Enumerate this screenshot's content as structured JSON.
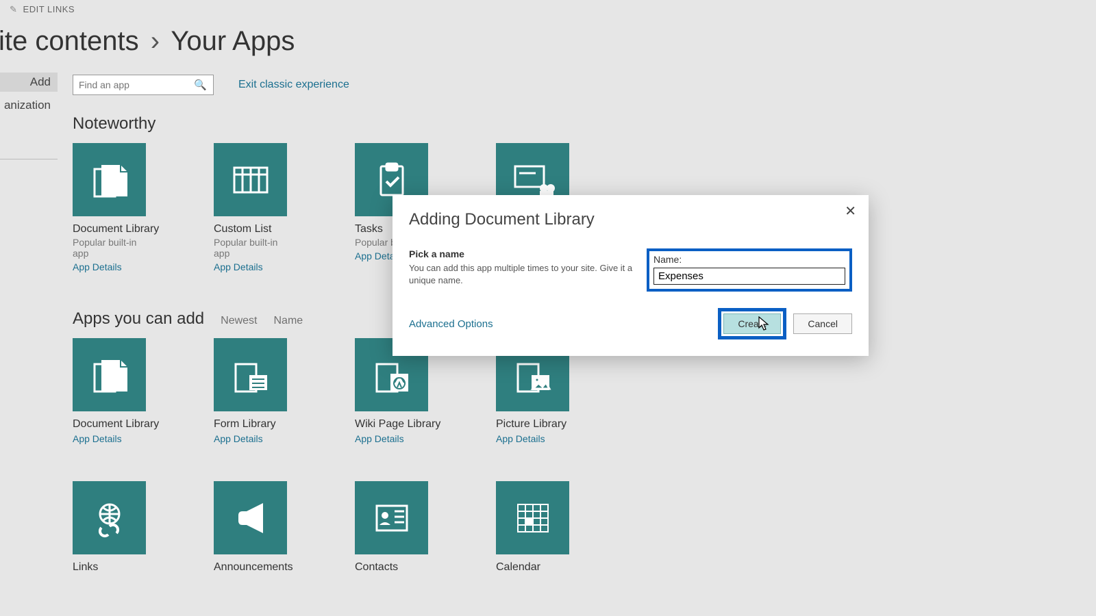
{
  "topbar": {
    "edit_links": "EDIT LINKS"
  },
  "breadcrumb": {
    "site_contents": "ite contents",
    "sep": "›",
    "your_apps": "Your Apps"
  },
  "sidebar": {
    "items": [
      "Add",
      "anization"
    ]
  },
  "search": {
    "placeholder": "Find an app"
  },
  "links": {
    "exit_classic": "Exit classic experience"
  },
  "sections": {
    "noteworthy": "Noteworthy",
    "apps_you_can_add": "Apps you can add",
    "sort_newest": "Newest",
    "sort_name": "Name"
  },
  "strings": {
    "popular": "Popular built-in app",
    "popular_cut": "Popular bu",
    "app_details": "App Details",
    "app_detail_cut": "App Detail"
  },
  "noteworthy": [
    {
      "title": "Document Library"
    },
    {
      "title": "Custom List"
    },
    {
      "title": "Tasks"
    },
    {
      "title": ""
    }
  ],
  "addable_row1": [
    {
      "title": "Document Library"
    },
    {
      "title": "Form Library"
    },
    {
      "title": "Wiki Page Library"
    },
    {
      "title": "Picture Library"
    }
  ],
  "addable_row2": [
    {
      "title": "Links"
    },
    {
      "title": "Announcements"
    },
    {
      "title": "Contacts"
    },
    {
      "title": "Calendar"
    }
  ],
  "dialog": {
    "title": "Adding Document Library",
    "pick_name": "Pick a name",
    "desc": "You can add this app multiple times to your site. Give it a unique name.",
    "name_label": "Name:",
    "name_value": "Expenses",
    "advanced": "Advanced Options",
    "create": "Create",
    "cancel": "Cancel"
  }
}
